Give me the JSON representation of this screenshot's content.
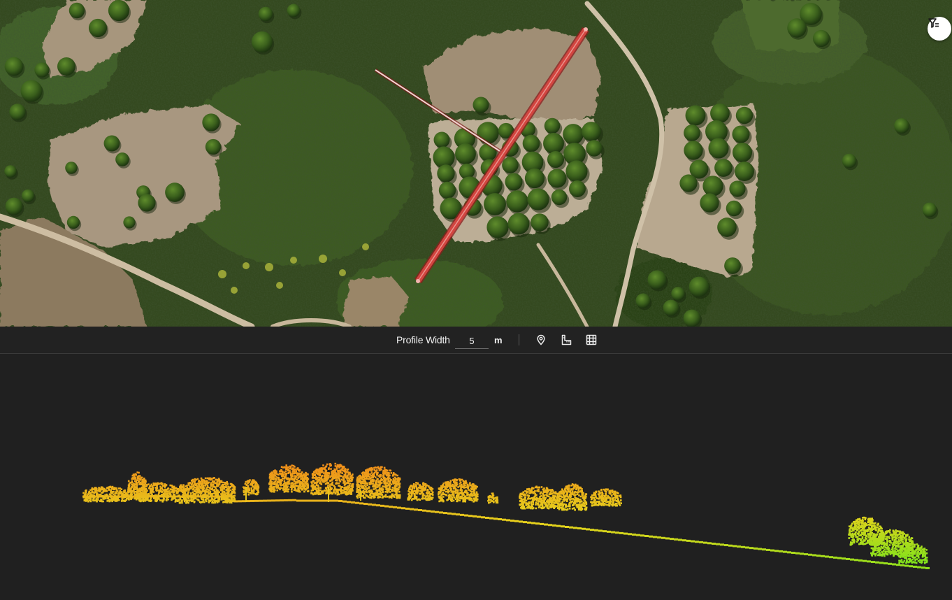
{
  "toolbar": {
    "profile_width_label": "Profile Width",
    "profile_width_value": "5",
    "profile_width_unit": "m",
    "icons": [
      "location-pin-icon",
      "ruler-measure-icon",
      "grid-icon"
    ]
  },
  "map": {
    "filter_icon": "filter-list-icon"
  },
  "colors": {
    "profile_line": "#c0302f",
    "toolbar_bg": "#222222",
    "profile_bg": "#202020",
    "cloud_high": "#f0901a",
    "cloud_mid": "#e6d21c",
    "cloud_low": "#7ee41c"
  }
}
